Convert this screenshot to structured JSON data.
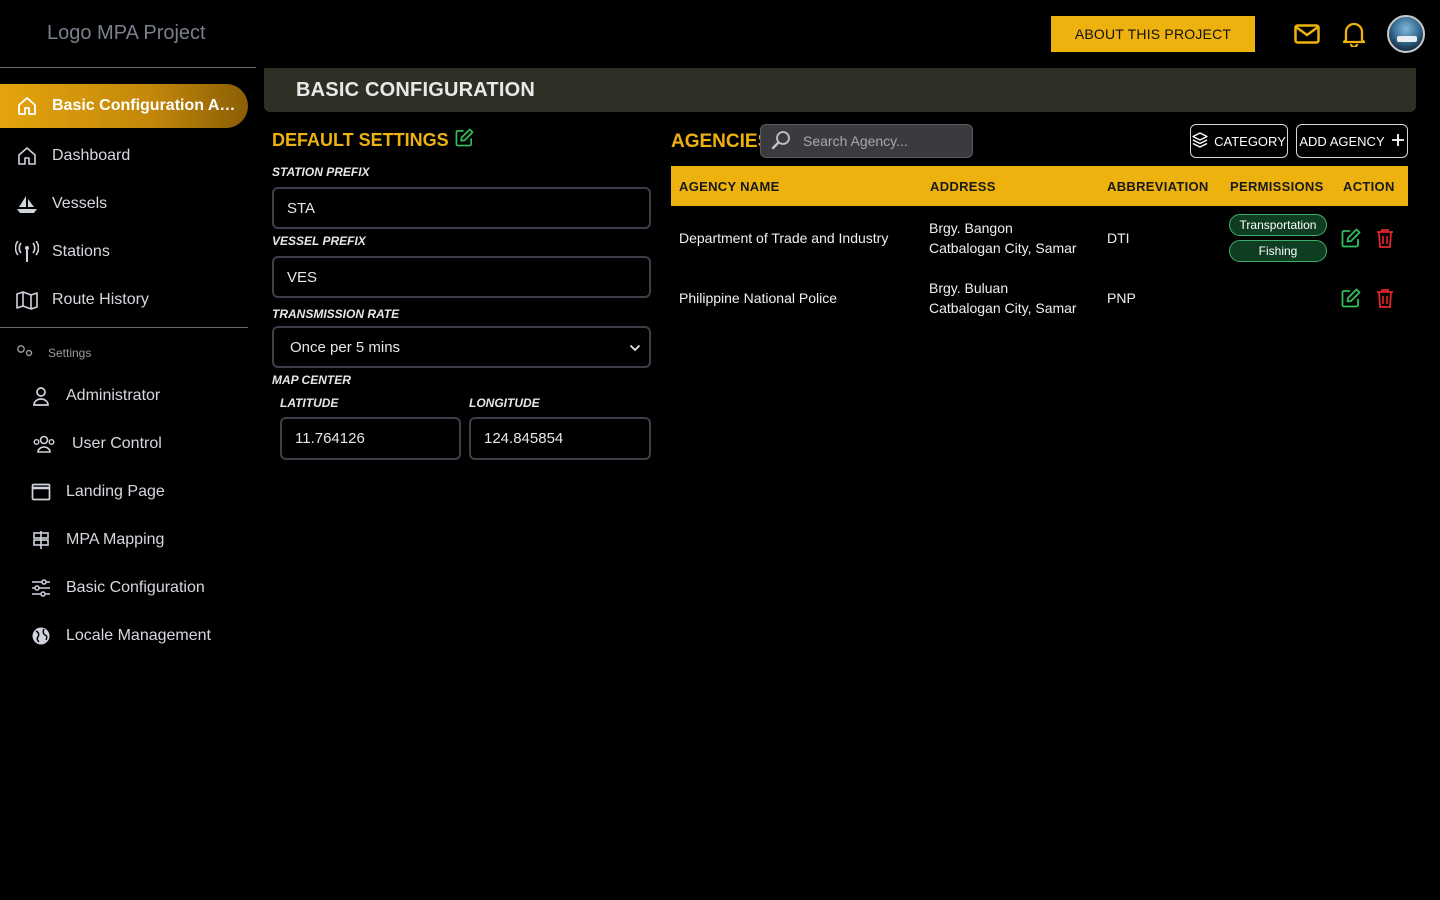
{
  "app": {
    "logo_text": "Logo MPA Project",
    "about_button": "ABOUT THIS PROJECT"
  },
  "sidebar": {
    "active_item": "Basic Configuration Act...",
    "items": [
      {
        "label": "Dashboard",
        "icon": "home-icon"
      },
      {
        "label": "Vessels",
        "icon": "sailboat-icon"
      },
      {
        "label": "Stations",
        "icon": "antenna-icon"
      },
      {
        "label": "Route History",
        "icon": "map-icon"
      }
    ],
    "settings_label": "Settings",
    "settings_items": [
      {
        "label": "Administrator",
        "icon": "user-icon"
      },
      {
        "label": "User Control",
        "icon": "users-icon"
      },
      {
        "label": "Landing Page",
        "icon": "window-icon"
      },
      {
        "label": "MPA Mapping",
        "icon": "signpost-icon"
      },
      {
        "label": "Basic Configuration",
        "icon": "sliders-icon"
      },
      {
        "label": "Locale Management",
        "icon": "globe-icon"
      }
    ]
  },
  "page": {
    "title": "BASIC CONFIGURATION"
  },
  "default_settings": {
    "title": "DEFAULT SETTINGS",
    "station_prefix_label": "STATION PREFIX",
    "station_prefix_value": "STA",
    "vessel_prefix_label": "VESSEL PREFIX",
    "vessel_prefix_value": "VES",
    "transmission_rate_label": "TRANSMISSION RATE",
    "transmission_rate_value": "Once per 5 mins",
    "map_center_label": "MAP CENTER",
    "latitude_label": "LATITUDE",
    "latitude_value": "11.764126",
    "longitude_label": "LONGITUDE",
    "longitude_value": "124.845854"
  },
  "agencies": {
    "title": "AGENCIES",
    "search_placeholder": "Search Agency...",
    "category_button": "CATEGORY",
    "add_button": "ADD AGENCY",
    "columns": [
      "AGENCY NAME",
      "ADDRESS",
      "ABBREVIATION",
      "PERMISSIONS",
      "ACTION"
    ],
    "rows": [
      {
        "name": "Department of Trade and Industry",
        "address_line1": "Brgy. Bangon",
        "address_line2": "Catbalogan City, Samar",
        "abbreviation": "DTI",
        "permissions": [
          "Transportation",
          "Fishing"
        ]
      },
      {
        "name": "Philippine National Police",
        "address_line1": "Brgy. Buluan",
        "address_line2": "Catbalogan City, Samar",
        "abbreviation": "PNP",
        "permissions": []
      }
    ]
  },
  "colors": {
    "accent": "#edb20e",
    "edit_green": "#2fbf5b",
    "delete_red": "#e0262b"
  }
}
